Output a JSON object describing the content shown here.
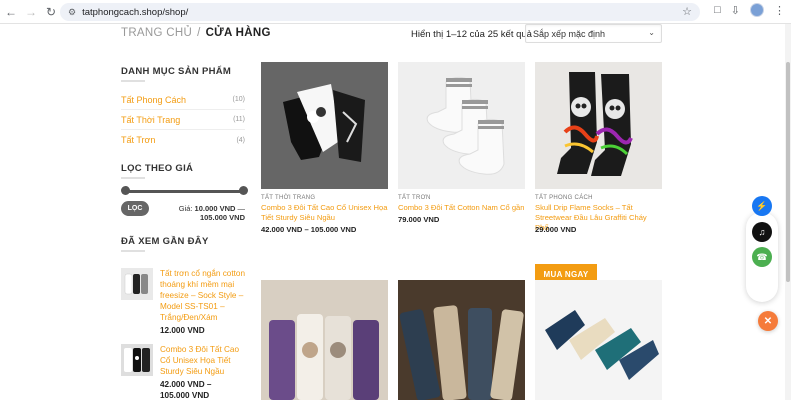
{
  "browser": {
    "url": "tatphongcach.shop/shop/"
  },
  "breadcrumb": {
    "home": "TRANG CHỦ",
    "separator": "/",
    "current": "CỬA HÀNG"
  },
  "toolbar": {
    "result_count": "Hiển thị 1–12 của 25 kết quả",
    "sort_selected": "Sắp xếp mặc định"
  },
  "sidebar": {
    "categories_title": "DANH MỤC SẢN PHẨM",
    "categories": [
      {
        "label": "Tất Phong Cách",
        "count": "(10)"
      },
      {
        "label": "Tất Thời Trang",
        "count": "(11)"
      },
      {
        "label": "Tất Trơn",
        "count": "(4)"
      }
    ],
    "price_title": "LỌC THEO GIÁ",
    "filter_button": "LỌC",
    "price_label": "Giá:",
    "price_min": "10.000 VND",
    "price_dash": "—",
    "price_max": "105.000 VND",
    "recent_title": "ĐÃ XEM GẦN ĐÂY",
    "recent": [
      {
        "title": "Tất trơn cổ ngắn cotton thoáng khí mềm mại freesize – Sock Style – Model SS-TS01 – Trắng/Đen/Xám",
        "price": "12.000 VND"
      },
      {
        "title": "Combo 3 Đôi Tất Cao Cổ Unisex Họa Tiết Sturdy Siêu Ngầu",
        "price_line1": "42.000 VND –",
        "price_line2": "105.000 VND"
      }
    ]
  },
  "products": [
    {
      "category": "TẤT THỜI TRANG",
      "title": "Combo 3 Đôi Tất Cao Cổ Unisex Họa Tiết Sturdy Siêu Ngầu",
      "price": "42.000 VND – 105.000 VND"
    },
    {
      "category": "TẤT TRƠN",
      "title": "Combo 3 Đôi Tất Cotton Nam Cổ gần",
      "price": "79.000 VND"
    },
    {
      "category": "TẤT PHONG CÁCH",
      "title": "Skull Drip Flame Socks – Tất Streetwear Đầu Lâu Graffiti Cháy Phố",
      "price": "29.000 VND",
      "button": "MUA NGAY"
    }
  ],
  "colors": {
    "accent": "#f39c12",
    "messenger": "#1877f2",
    "tiktok": "#111111",
    "phone": "#4caf50",
    "close": "#f57b3a"
  },
  "icons": [
    "back-icon",
    "forward-icon",
    "reload-icon",
    "site-info-icon",
    "star-icon",
    "extensions-icon",
    "download-icon",
    "messenger-icon",
    "tiktok-icon",
    "phone-icon",
    "close-icon"
  ]
}
